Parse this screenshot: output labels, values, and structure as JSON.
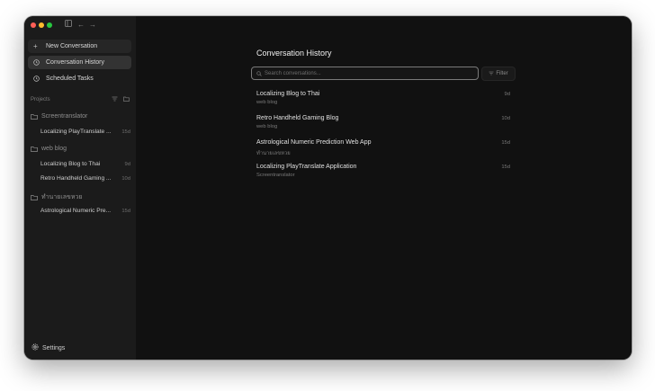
{
  "sidebar": {
    "new_conversation": "New Conversation",
    "conversation_history": "Conversation History",
    "scheduled_tasks": "Scheduled Tasks",
    "projects_label": "Projects",
    "settings": "Settings",
    "projects": [
      {
        "name": "Screentranslator",
        "items": [
          {
            "title": "Localizing PlayTranslate ...",
            "age": "15d"
          }
        ]
      },
      {
        "name": "web blog",
        "items": [
          {
            "title": "Localizing Blog to Thai",
            "age": "9d"
          },
          {
            "title": "Retro Handheld Gaming ...",
            "age": "10d"
          }
        ]
      },
      {
        "name": "ทำนายเลขหวย",
        "items": [
          {
            "title": "Astrological Numeric Pre...",
            "age": "15d"
          }
        ]
      }
    ]
  },
  "main": {
    "title": "Conversation History",
    "search_placeholder": "Search conversations...",
    "filter_label": "Filter",
    "history": [
      {
        "title": "Localizing Blog to Thai",
        "project": "web blog",
        "age": "9d"
      },
      {
        "title": "Retro Handheld Gaming Blog",
        "project": "web blog",
        "age": "10d"
      },
      {
        "title": "Astrological Numeric Prediction Web App",
        "project": "ทำนายเลขหวย",
        "age": "15d"
      },
      {
        "title": "Localizing PlayTranslate Application",
        "project": "Screentranslator",
        "age": "15d"
      }
    ]
  },
  "icons": {
    "traffic_lights": [
      "close",
      "minimize",
      "zoom"
    ],
    "toolbar": [
      "sidebar-toggle-icon",
      "back-arrow-icon",
      "forward-arrow-icon"
    ]
  },
  "colors": {
    "window_bg": "#111111",
    "sidebar_bg": "#1b1b1b",
    "active_item_bg": "#333333",
    "search_border": "#7a7a7a"
  }
}
